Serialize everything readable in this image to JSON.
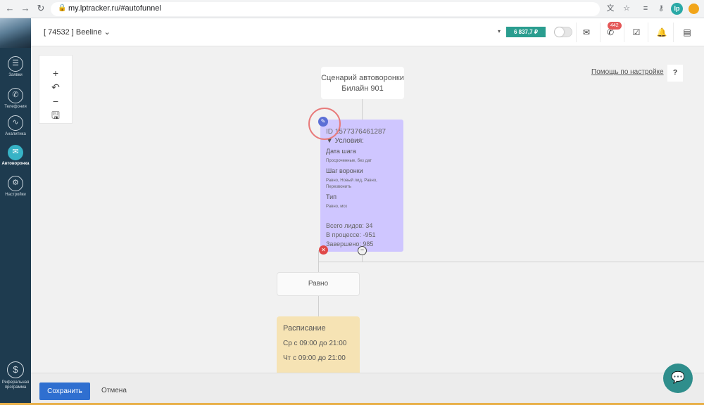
{
  "browser": {
    "url": "my.lptracker.ru/#autofunnel",
    "profile_initials": "lp"
  },
  "sidebar": {
    "items": [
      {
        "label": "Заявки",
        "icon": "list-icon",
        "glyph": "☰"
      },
      {
        "label": "Телефония",
        "icon": "phone-icon",
        "glyph": "✆"
      },
      {
        "label": "Аналитика",
        "icon": "chart-icon",
        "glyph": "∿"
      },
      {
        "label": "Автоворонка",
        "icon": "mail-icon",
        "glyph": "✉"
      },
      {
        "label": "Настройки",
        "icon": "gear-icon",
        "glyph": "⚙"
      }
    ],
    "referral": {
      "label": "Реферальная программа",
      "icon": "dollar-icon",
      "glyph": "$"
    }
  },
  "header": {
    "project": "[ 74532 ] Beeline ⌄",
    "balance": "6 837,7 ₽",
    "call_badge": "442"
  },
  "canvas": {
    "help_link": "Помощь по настройке",
    "help_button": "?",
    "start_node": {
      "line1": "Сценарий автоворонки",
      "line2": "Билайн 901"
    },
    "condition_node": {
      "id": "ID 1577376461287",
      "title": "▼ Условия:",
      "fields": [
        {
          "name": "Дата шага",
          "value": "Просроченные, без дат"
        },
        {
          "name": "Шаг воронки",
          "value": "Равно, Новый лид, Равно, Перезвонить"
        },
        {
          "name": "Тип",
          "value": "Равно, мск"
        }
      ],
      "stats": {
        "total": "Всего лидов: 34",
        "in_progress": "В процессе: -951",
        "done": "Завершено: 985"
      }
    },
    "equals_node": "Равно",
    "schedule_node": {
      "title": "Расписание",
      "rows": [
        "Ср с 09:00 до 21:00",
        "Чт с 09:00 до 21:00"
      ]
    }
  },
  "footer": {
    "save": "Сохранить",
    "cancel": "Отмена"
  },
  "colors": {
    "sidebar": "#1e3b4f",
    "condition_node": "#cfc6ff",
    "schedule_node": "#f6e3b4",
    "save_button": "#2f6fd0",
    "balance": "#2a9d8f"
  }
}
